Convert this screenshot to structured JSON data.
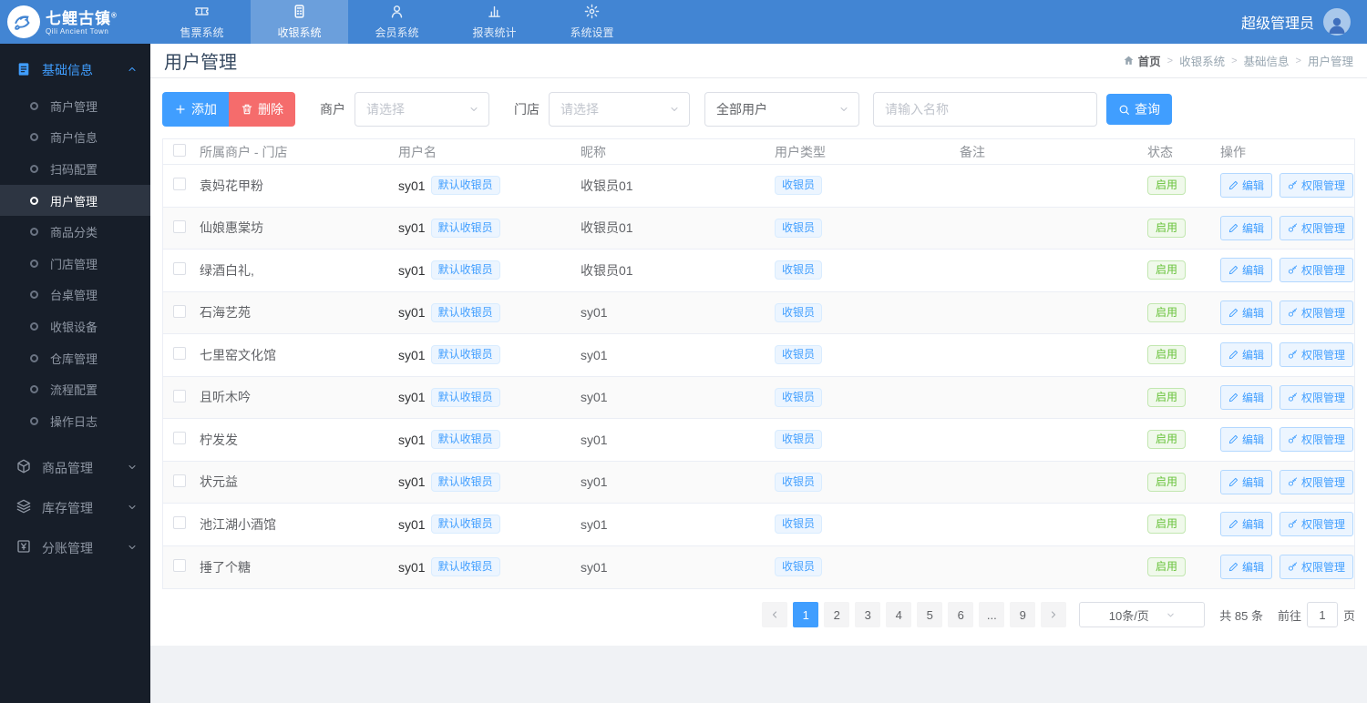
{
  "colors": {
    "primary": "#409eff",
    "navbar_blue": "#4285d3",
    "sidebar_bg": "#171e29",
    "danger_red": "#f56c6c",
    "success_green": "#67c23a",
    "page_bg": "#f0f2f5"
  },
  "navbar": {
    "logo_title": "七鲤古镇",
    "logo_sup": "®",
    "logo_subtitle": "Qili Ancient Town",
    "items": [
      {
        "label": "售票系统",
        "icon": "ticket-icon",
        "active": false
      },
      {
        "label": "收银系统",
        "icon": "pos-icon",
        "active": true
      },
      {
        "label": "会员系统",
        "icon": "member-icon",
        "active": false
      },
      {
        "label": "报表统计",
        "icon": "bar-chart-icon",
        "active": false
      },
      {
        "label": "系统设置",
        "icon": "gear-icon",
        "active": false
      }
    ],
    "user_name": "超级管理员"
  },
  "sidebar": {
    "sections": [
      {
        "label": "基础信息",
        "icon": "document-icon",
        "expanded": true,
        "chevron": "chevron-up-icon",
        "items": [
          {
            "label": "商户管理",
            "active": false
          },
          {
            "label": "商户信息",
            "active": false
          },
          {
            "label": "扫码配置",
            "active": false
          },
          {
            "label": "用户管理",
            "active": true
          },
          {
            "label": "商品分类",
            "active": false
          },
          {
            "label": "门店管理",
            "active": false
          },
          {
            "label": "台桌管理",
            "active": false
          },
          {
            "label": "收银设备",
            "active": false
          },
          {
            "label": "仓库管理",
            "active": false
          },
          {
            "label": "流程配置",
            "active": false
          },
          {
            "label": "操作日志",
            "active": false
          }
        ]
      },
      {
        "label": "商品管理",
        "icon": "cube-icon",
        "expanded": false,
        "chevron": "chevron-down-icon",
        "items": []
      },
      {
        "label": "库存管理",
        "icon": "layers-icon",
        "expanded": false,
        "chevron": "chevron-down-icon",
        "items": []
      },
      {
        "label": "分账管理",
        "icon": "yen-square-icon",
        "expanded": false,
        "chevron": "chevron-down-icon",
        "items": []
      }
    ]
  },
  "page": {
    "title": "用户管理",
    "breadcrumb": [
      "首页",
      "收银系统",
      "基础信息",
      "用户管理"
    ]
  },
  "toolbar": {
    "add_label": "添加",
    "delete_label": "删除",
    "merchant_label": "商户",
    "store_label": "门店",
    "select_placeholder": "请选择",
    "user_type_value": "全部用户",
    "search_placeholder": "请输入名称",
    "search_label": "查询"
  },
  "table": {
    "columns": [
      "所属商户 - 门店",
      "用户名",
      "昵称",
      "用户类型",
      "备注",
      "状态",
      "操作"
    ],
    "edit_label": "编辑",
    "permission_label": "权限管理",
    "rows": [
      {
        "merchant": "袁妈花甲粉",
        "username": "sy01",
        "username_tag": "默认收银员",
        "nickname": "收银员01",
        "user_type": "收银员",
        "remark": "",
        "status": "启用"
      },
      {
        "merchant": "仙娘惠棠坊",
        "username": "sy01",
        "username_tag": "默认收银员",
        "nickname": "收银员01",
        "user_type": "收银员",
        "remark": "",
        "status": "启用"
      },
      {
        "merchant": "绿酒白礼,",
        "username": "sy01",
        "username_tag": "默认收银员",
        "nickname": "收银员01",
        "user_type": "收银员",
        "remark": "",
        "status": "启用"
      },
      {
        "merchant": "石海艺苑",
        "username": "sy01",
        "username_tag": "默认收银员",
        "nickname": "sy01",
        "user_type": "收银员",
        "remark": "",
        "status": "启用"
      },
      {
        "merchant": "七里窑文化馆",
        "username": "sy01",
        "username_tag": "默认收银员",
        "nickname": "sy01",
        "user_type": "收银员",
        "remark": "",
        "status": "启用"
      },
      {
        "merchant": "且听木吟",
        "username": "sy01",
        "username_tag": "默认收银员",
        "nickname": "sy01",
        "user_type": "收银员",
        "remark": "",
        "status": "启用"
      },
      {
        "merchant": "柠发发",
        "username": "sy01",
        "username_tag": "默认收银员",
        "nickname": "sy01",
        "user_type": "收银员",
        "remark": "",
        "status": "启用"
      },
      {
        "merchant": "状元益",
        "username": "sy01",
        "username_tag": "默认收银员",
        "nickname": "sy01",
        "user_type": "收银员",
        "remark": "",
        "status": "启用"
      },
      {
        "merchant": "池江湖小酒馆",
        "username": "sy01",
        "username_tag": "默认收银员",
        "nickname": "sy01",
        "user_type": "收银员",
        "remark": "",
        "status": "启用"
      },
      {
        "merchant": "捶了个糖",
        "username": "sy01",
        "username_tag": "默认收银员",
        "nickname": "sy01",
        "user_type": "收银员",
        "remark": "",
        "status": "启用"
      }
    ]
  },
  "pagination": {
    "pages": [
      "1",
      "2",
      "3",
      "4",
      "5",
      "6",
      "...",
      "9"
    ],
    "active_page": "1",
    "page_size": "10条/页",
    "total": "共 85 条",
    "goto_prefix": "前往",
    "goto_value": "1",
    "goto_suffix": "页"
  }
}
